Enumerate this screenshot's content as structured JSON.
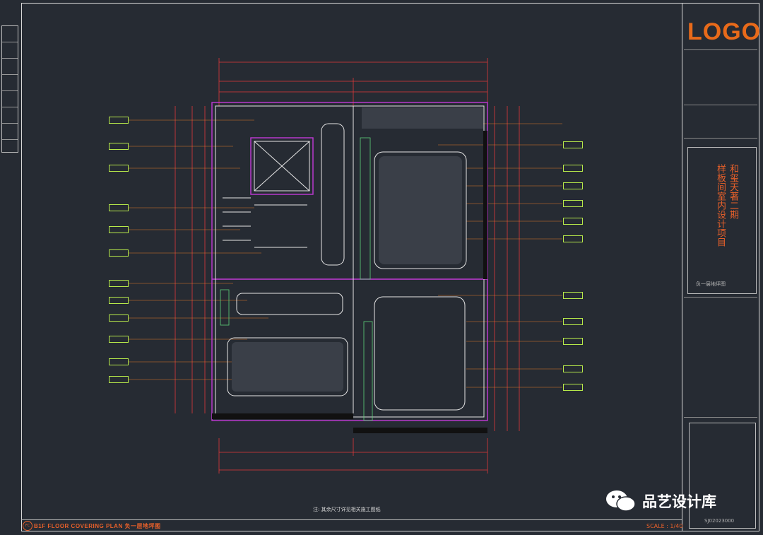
{
  "logo": "LOGO",
  "project_title_lines": [
    "和玺天著二期",
    "样板间室内设计项目"
  ],
  "sheet_name": "负一层地坪图",
  "drawing_title": "B1F FLOOR COVERING PLAN  负一层地坪图",
  "drawing_label": "FC",
  "scale": "SCALE : 1/40",
  "drawing_number": "SJ02023000",
  "note": "注: 其余尺寸详见相关施工图纸",
  "watermark": "品艺设计库",
  "colors": {
    "background": "#262b33",
    "accent_orange": "#e8602a",
    "tag_green": "#b7e94a",
    "dim_red": "#e03a3a",
    "wall_magenta": "#c23ad8",
    "wall_white": "#e6e6e6"
  }
}
